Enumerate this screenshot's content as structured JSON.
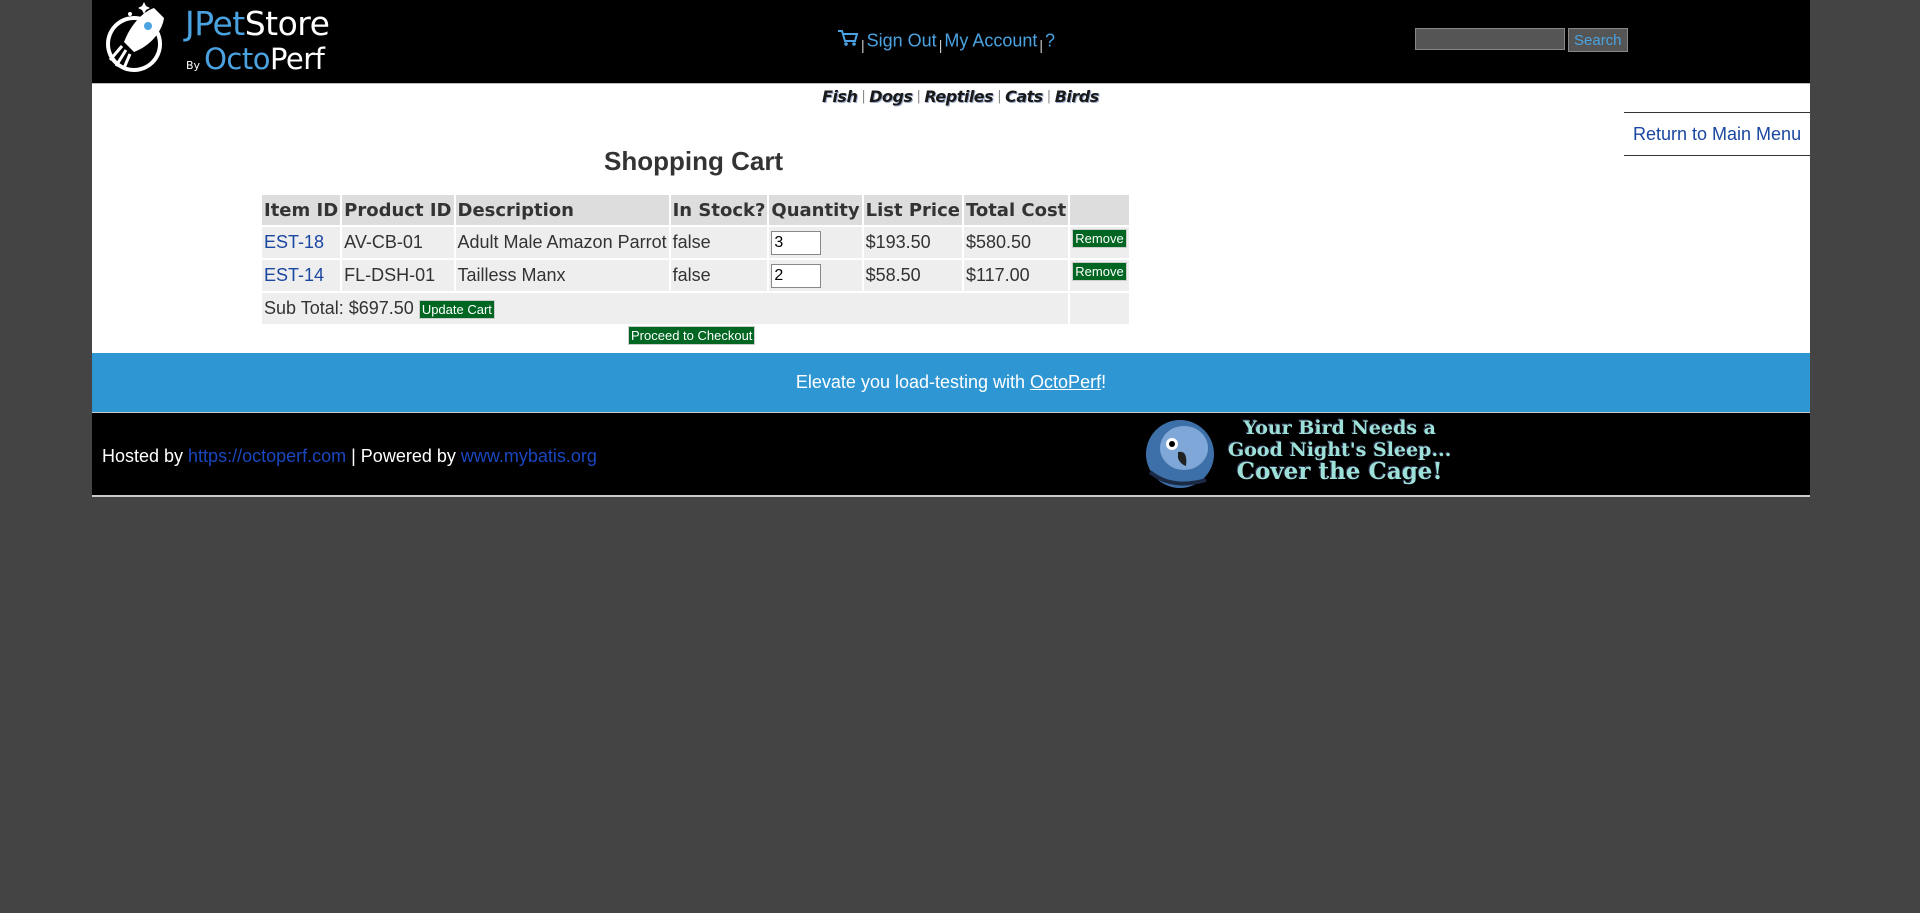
{
  "header": {
    "logo": {
      "j": "JPet",
      "store": "Store",
      "by": "By",
      "octo": "Octo",
      "perf": "Perf"
    },
    "menu": {
      "sign_out": "Sign Out",
      "my_account": "My Account",
      "help": "?",
      "separator": "|"
    },
    "search": {
      "button": "Search",
      "value": ""
    }
  },
  "quicklinks": [
    "Fish",
    "Dogs",
    "Reptiles",
    "Cats",
    "Birds"
  ],
  "return_menu": "Return to Main Menu",
  "cart": {
    "title": "Shopping Cart",
    "columns": [
      "Item ID",
      "Product ID",
      "Description",
      "In Stock?",
      "Quantity",
      "List Price",
      "Total Cost",
      ""
    ],
    "rows": [
      {
        "item_id": "EST-18",
        "product_id": "AV-CB-01",
        "description": "Adult Male Amazon Parrot",
        "in_stock": "false",
        "quantity": "3",
        "list_price": "$193.50",
        "total_cost": "$580.50",
        "remove": "Remove"
      },
      {
        "item_id": "EST-14",
        "product_id": "FL-DSH-01",
        "description": "Tailless Manx",
        "in_stock": "false",
        "quantity": "2",
        "list_price": "$58.50",
        "total_cost": "$117.00",
        "remove": "Remove"
      }
    ],
    "subtotal": "Sub Total: $697.50",
    "update_button": "Update Cart",
    "checkout_button": "Proceed to Checkout"
  },
  "banner": {
    "text": "Elevate you load-testing with ",
    "link": "OctoPerf",
    "suffix": "!"
  },
  "footer": {
    "hosted_by": "Hosted by ",
    "hosted_link": "https://octoperf.com",
    "powered_by": " | Powered by ",
    "powered_link": "www.mybatis.org",
    "ad": {
      "line1": "Your Bird Needs a",
      "line2": "Good Night's Sleep...",
      "line3": "Cover the Cage!"
    }
  },
  "colors": {
    "accent": "#2f96d4",
    "button_green": "#006622",
    "link": "#1a47a0",
    "background": "#444444"
  }
}
